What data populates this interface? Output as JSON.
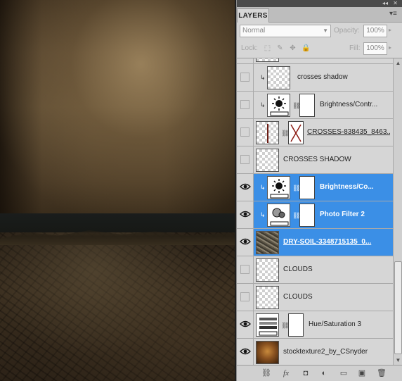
{
  "panel": {
    "collapse_glyph": "◂◂",
    "close_glyph": "✕",
    "tab_label": "LAYERS",
    "menu_glyph": "▾≡",
    "blend_mode": "Normal",
    "opacity_label": "Opacity:",
    "opacity_value": "100%",
    "lock_label": "Lock:",
    "fill_label": "Fill:",
    "fill_value": "100%",
    "lock_icons": [
      "lock-transparent-icon",
      "lock-image-icon",
      "lock-position-icon",
      "lock-all-icon"
    ]
  },
  "layers": [
    {
      "name": "crosses shadow",
      "visible": false,
      "selected": false,
      "clipped": true,
      "type": "raster-empty"
    },
    {
      "name": "Brightness/Contr...",
      "visible": false,
      "selected": false,
      "clipped": true,
      "type": "brightness-adjustment"
    },
    {
      "name": "CROSSES-838435_8463...",
      "visible": false,
      "selected": false,
      "clipped": false,
      "type": "smart-object"
    },
    {
      "name": "CROSSES SHADOW",
      "visible": false,
      "selected": false,
      "clipped": false,
      "type": "raster-empty"
    },
    {
      "name": "Brightness/Co...",
      "visible": true,
      "selected": true,
      "clipped": true,
      "type": "brightness-adjustment"
    },
    {
      "name": "Photo Filter 2",
      "visible": true,
      "selected": true,
      "clipped": true,
      "type": "photo-filter-adjustment"
    },
    {
      "name": "DRY-SOIL-3348715135_0...",
      "visible": true,
      "selected": true,
      "clipped": false,
      "type": "raster-photo"
    },
    {
      "name": "CLOUDS",
      "visible": false,
      "selected": false,
      "clipped": false,
      "type": "raster-empty"
    },
    {
      "name": "CLOUDS",
      "visible": false,
      "selected": false,
      "clipped": false,
      "type": "raster-empty"
    },
    {
      "name": "Hue/Saturation 3",
      "visible": true,
      "selected": false,
      "clipped": false,
      "type": "hue-saturation-adjustment"
    },
    {
      "name": "stocktexture2_by_CSnyder",
      "visible": true,
      "selected": false,
      "clipped": false,
      "type": "raster-texture"
    }
  ],
  "footer_icons": [
    "link-layers-icon",
    "fx-icon",
    "add-mask-icon",
    "adjustment-layer-icon",
    "new-group-icon",
    "new-layer-icon",
    "trash-icon"
  ],
  "footer_glyphs": [
    "⛓",
    "fx",
    "◘",
    "◐",
    "▭",
    "▣",
    "🗑"
  ],
  "colors": {
    "selection": "#3b8fe6",
    "panel_bg": "#d6d6d6"
  }
}
